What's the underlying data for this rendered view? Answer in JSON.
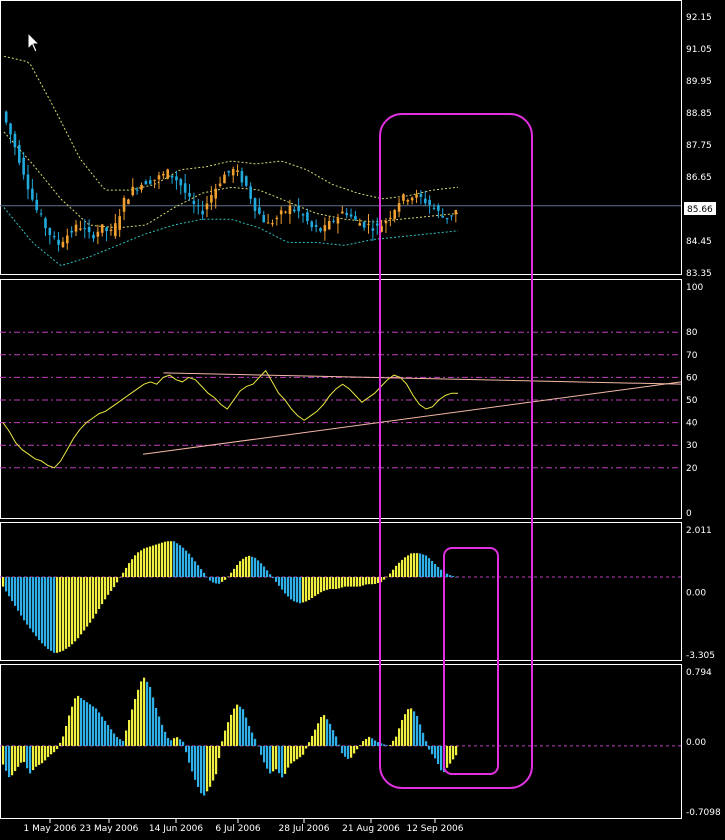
{
  "colors": {
    "background": "#000000",
    "frame": "#ffffff",
    "bull_candle": "#f0a030",
    "bear_candle": "#22aadd",
    "bollinger": "#d8d870",
    "bollinger_lower": "#30c0c0",
    "price_line": "#607090",
    "rsi_line": "#e8e840",
    "trendline": "#f4b8a8",
    "level_line": "#c040c0",
    "hist_yellow": "#f0f040",
    "hist_blue": "#30b0e8",
    "highlight": "#e030e0",
    "price_box_bg": "#ffffff",
    "price_box_text": "#000000"
  },
  "cursor_icon": "arrow-cursor",
  "chart_data": [
    {
      "type": "candlestick",
      "panel": "price",
      "ylim": [
        83.35,
        92.15
      ],
      "y_ticks": [
        "92.15",
        "91.05",
        "89.95",
        "88.85",
        "87.75",
        "86.65",
        "85.55",
        "84.45",
        "83.35"
      ],
      "current_price": "85.66",
      "x_dates": [
        "1 May 2006",
        "23 May 2006",
        "14 Jun 2006",
        "6 Jul 2006",
        "28 Jul 2006",
        "21 Aug 2006",
        "12 Sep 2006"
      ],
      "bars": 104,
      "close_path": [
        88.9,
        87.9,
        86.8,
        85.6,
        84.9,
        84.3,
        84.7,
        85.0,
        84.6,
        84.9,
        84.7,
        85.8,
        86.3,
        86.5,
        86.6,
        86.8,
        86.5,
        85.8,
        85.4,
        86.1,
        86.7,
        86.9,
        86.4,
        85.5,
        85.0,
        85.3,
        85.6,
        85.4,
        84.9,
        84.8,
        85.2,
        85.5,
        85.1,
        85.0,
        84.9,
        85.3,
        85.9,
        86.0,
        85.9,
        85.6,
        85.2,
        85.5
      ],
      "upper_band_path": [
        90.8,
        90.6,
        89.0,
        87.3,
        86.2,
        86.2,
        86.4,
        86.9,
        87.0,
        87.2,
        87.1,
        87.2,
        86.9,
        86.4,
        86.1,
        85.9,
        86.0,
        86.2,
        86.3
      ],
      "middle_band_path": [
        88.2,
        87.1,
        85.9,
        85.0,
        84.9,
        85.0,
        85.6,
        86.1,
        86.3,
        86.2,
        85.8,
        85.4,
        85.2,
        85.1,
        85.2,
        85.3,
        85.4
      ],
      "lower_band_path": [
        85.6,
        84.4,
        83.6,
        83.9,
        84.3,
        84.7,
        85.0,
        85.2,
        85.2,
        84.9,
        84.4,
        84.4,
        84.3,
        84.5,
        84.6,
        84.7,
        84.8
      ]
    },
    {
      "type": "line",
      "panel": "oscillator",
      "ylim": [
        0,
        100
      ],
      "y_ticks": [
        "100",
        "80",
        "70",
        "60",
        "50",
        "40",
        "30",
        "20",
        "0"
      ],
      "levels": [
        80,
        70,
        60,
        50,
        40,
        30,
        20
      ],
      "values": [
        40,
        36,
        31,
        28,
        26,
        24,
        23,
        21,
        20,
        23,
        28,
        33,
        37,
        40,
        42,
        44,
        45,
        47,
        49,
        51,
        53,
        55,
        57,
        58,
        57,
        60,
        61,
        59,
        58,
        60,
        59,
        56,
        53,
        51,
        48,
        46,
        50,
        54,
        56,
        57,
        60,
        63,
        58,
        53,
        50,
        46,
        43,
        41,
        43,
        45,
        48,
        52,
        55,
        57,
        55,
        52,
        49,
        51,
        53,
        56,
        59,
        61,
        60,
        57,
        52,
        48,
        46,
        47,
        50,
        52,
        53,
        53
      ],
      "trend_upper": [
        [
          0.24,
          62
        ],
        [
          1.0,
          57
        ]
      ],
      "trend_lower": [
        [
          0.21,
          26
        ],
        [
          1.0,
          58
        ]
      ]
    },
    {
      "type": "histogram",
      "panel": "macd",
      "ylim": [
        -3.305,
        2.011
      ],
      "y_ticks": [
        "2.011",
        "0.00",
        "-3.305"
      ],
      "values": [
        -0.4,
        -0.9,
        -1.4,
        -1.9,
        -2.3,
        -2.7,
        -3.0,
        -3.2,
        -3.1,
        -2.9,
        -2.6,
        -2.2,
        -1.8,
        -1.3,
        -0.8,
        -0.4,
        0.1,
        0.6,
        1.0,
        1.2,
        1.3,
        1.4,
        1.5,
        1.5,
        1.3,
        1.0,
        0.6,
        0.2,
        -0.2,
        -0.3,
        -0.1,
        0.3,
        0.7,
        0.9,
        0.8,
        0.5,
        0.1,
        -0.3,
        -0.7,
        -1.0,
        -1.1,
        -1.0,
        -0.8,
        -0.6,
        -0.5,
        -0.5,
        -0.4,
        -0.4,
        -0.4,
        -0.3,
        -0.3,
        -0.2,
        0.1,
        0.5,
        0.8,
        1.0,
        1.0,
        0.9,
        0.6,
        0.3,
        0.1,
        0.0
      ]
    },
    {
      "type": "histogram",
      "panel": "momentum",
      "ylim": [
        -0.7098,
        0.794
      ],
      "y_ticks": [
        "0.794",
        "0.00",
        "-0.7098"
      ],
      "values": [
        -0.2,
        -0.35,
        -0.25,
        -0.15,
        -0.3,
        -0.22,
        -0.18,
        -0.1,
        -0.05,
        0.1,
        0.35,
        0.55,
        0.5,
        0.45,
        0.4,
        0.3,
        0.2,
        0.1,
        0.05,
        0.3,
        0.55,
        0.75,
        0.65,
        0.4,
        0.2,
        0.05,
        0.1,
        0.05,
        -0.2,
        -0.4,
        -0.55,
        -0.45,
        -0.3,
        0.1,
        0.3,
        0.45,
        0.4,
        0.2,
        0.05,
        -0.15,
        -0.3,
        -0.25,
        -0.35,
        -0.2,
        -0.15,
        -0.1,
        0.05,
        0.2,
        0.35,
        0.25,
        0.1,
        -0.1,
        -0.15,
        -0.05,
        0.05,
        0.1,
        0.05,
        0.02,
        0.0,
        0.1,
        0.3,
        0.42,
        0.35,
        0.15,
        -0.05,
        -0.15,
        -0.3,
        -0.2,
        -0.1
      ]
    }
  ]
}
